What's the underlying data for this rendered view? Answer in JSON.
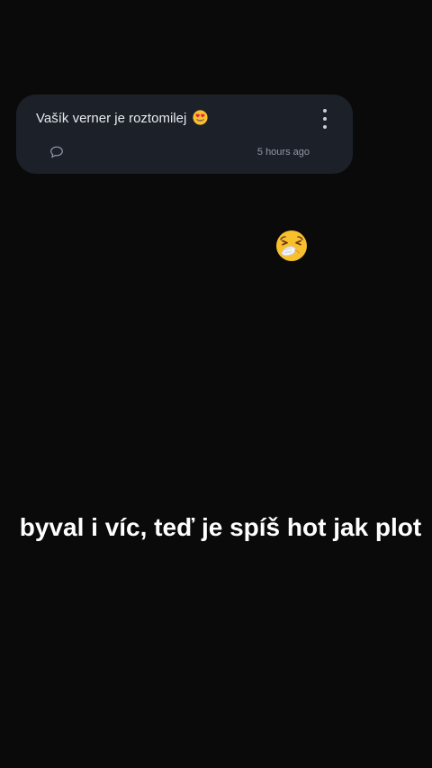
{
  "question": {
    "text": "Vašík verner je roztomilej",
    "emoji": "heart-eyes-emoji",
    "timestamp": "5 hours ago"
  },
  "sticker": {
    "emoji": "sneezing-face-emoji"
  },
  "caption": {
    "text": "byval i víc, teď je spíš hot jak plot"
  }
}
